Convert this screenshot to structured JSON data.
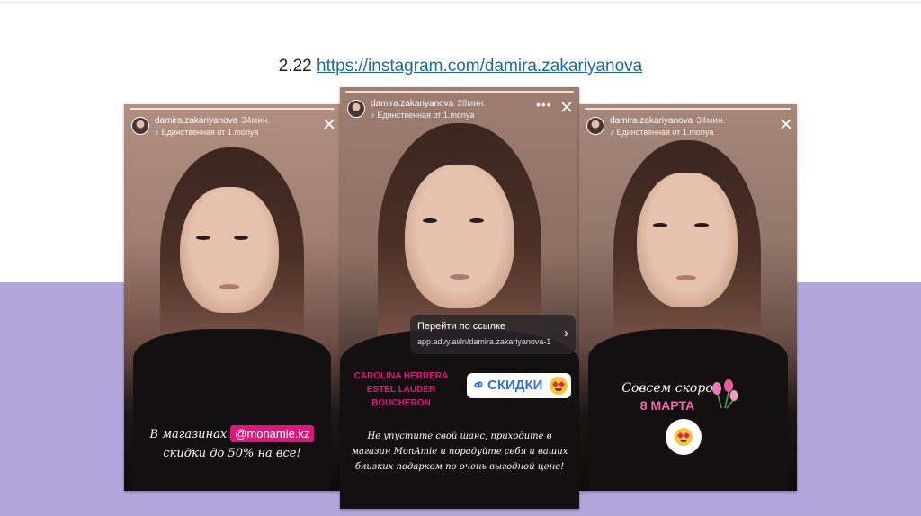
{
  "caption": {
    "number": "2.22",
    "link": "https://instagram.com/damira.zakariyanova"
  },
  "stories": [
    {
      "username": "damira.zakariyanova",
      "time": "34мин.",
      "music": "Единственная от 1.monya",
      "text_line1": "В магазинах",
      "mention": "@monamie.kz",
      "text_line2": "скидки до 50% на все!"
    },
    {
      "username": "damira.zakariyanova",
      "time": "28мин.",
      "music": "Единственная от 1.monya",
      "link_card": {
        "title": "Перейти по ссылке",
        "url": "app.advy.ai/ln/damira.zakariyanova-1"
      },
      "brands": [
        "CAROLINA HERRERA",
        "ESTEL LAUDER",
        "BOUCHERON"
      ],
      "sticker_label": "СКИДКИ",
      "body_lines": [
        "Не упустите свой шанс, приходите в",
        "магазин MonAmie и порадуйте себя и ваших",
        "близких подарком по очень выгодной цене!"
      ]
    },
    {
      "username": "damira.zakariyanova",
      "time": "34мин.",
      "music": "Единственная от 1.monya",
      "line1": "Совсем скоро",
      "line2": "8 МАРТА"
    }
  ],
  "colors": {
    "band": "#b3a6dc",
    "mention_bg": "#e0157a",
    "link_sticker_text": "#2d6ee8",
    "holiday_text": "#ff5fb0"
  },
  "icons": [
    "music-note-icon",
    "more-dots-icon",
    "close-icon",
    "link-icon",
    "heart-eyes-emoji",
    "tulips-icon"
  ]
}
